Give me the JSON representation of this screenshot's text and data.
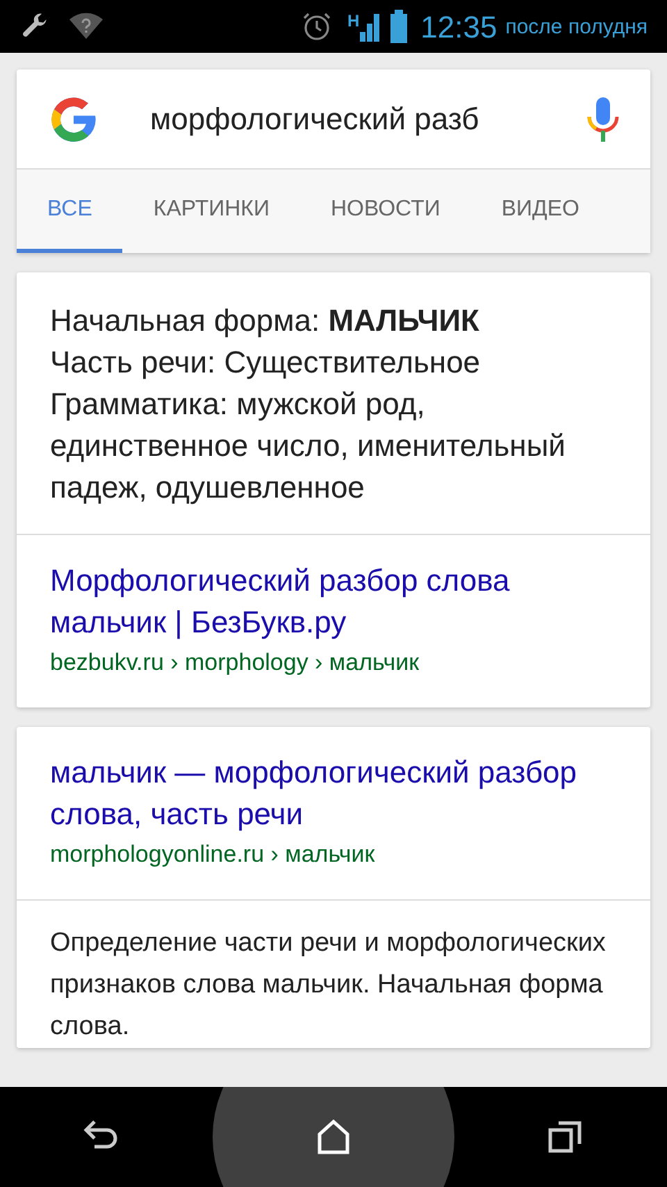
{
  "status_bar": {
    "network_label": "H",
    "time": "12:35",
    "period": "после полудня"
  },
  "search": {
    "value": "морфологический разб"
  },
  "tabs": [
    {
      "label": "ВСЕ",
      "selected": true
    },
    {
      "label": "КАРТИНКИ",
      "selected": false
    },
    {
      "label": "НОВОСТИ",
      "selected": false
    },
    {
      "label": "ВИДЕО",
      "selected": false
    }
  ],
  "answer_card": {
    "lines": [
      "Начальная форма: **МАЛЬЧИК**",
      "Часть речи: Существительное",
      "Грамматика: мужской род, единственное число, именительный падеж, одушевленное"
    ],
    "result": {
      "title": "Морфологический разбор слова мальчик | БезБукв.ру",
      "url": "bezbukv.ru › morphology › мальчик"
    }
  },
  "result_card": {
    "title": "мальчик — морфологический разбор слова, часть речи",
    "url": "morphologyonline.ru › мальчик",
    "snippet": "Определение части речи и морфологических признаков слова мальчик. Начальная форма слова."
  }
}
